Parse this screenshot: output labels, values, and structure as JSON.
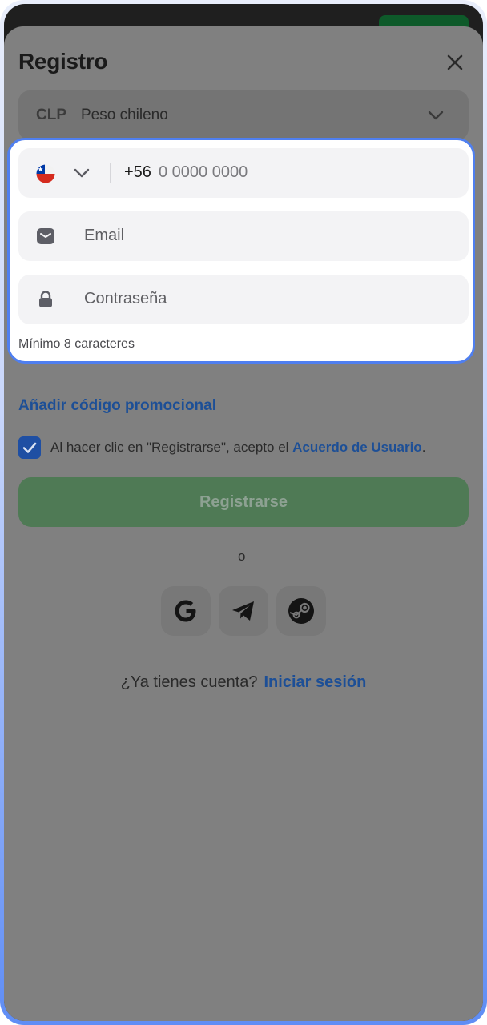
{
  "header": {
    "title": "Registro"
  },
  "currency": {
    "code": "CLP",
    "name": "Peso chileno"
  },
  "phone": {
    "prefix": "+56",
    "placeholder": "0 0000 0000"
  },
  "email": {
    "placeholder": "Email"
  },
  "password": {
    "placeholder": "Contraseña",
    "hint": "Mínimo 8 caracteres"
  },
  "promo": {
    "label": "Añadir código promocional"
  },
  "terms": {
    "text": "Al hacer clic en \"Registrarse\", acepto el ",
    "link": "Acuerdo de Usuario",
    "end": ".",
    "checked": true
  },
  "register": {
    "label": "Registrarse"
  },
  "divider": {
    "text": "o"
  },
  "social": [
    "google-icon",
    "telegram-icon",
    "steam-icon"
  ],
  "login": {
    "question": "¿Ya tienes cuenta?",
    "link": "Iniciar sesión"
  },
  "colors": {
    "accent": "#4f7ff0",
    "link": "#1d4f96",
    "button": "#4f7a55"
  }
}
